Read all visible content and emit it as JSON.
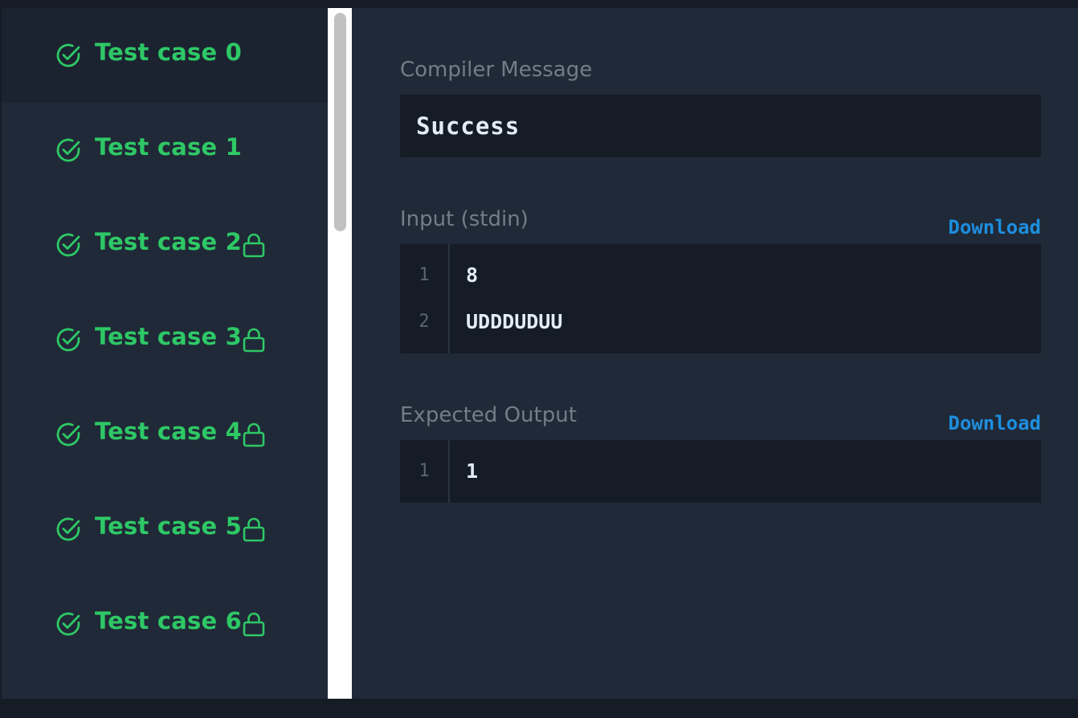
{
  "sidebar": {
    "items": [
      {
        "label": "Test case 0",
        "locked": false,
        "active": true,
        "status": "passed"
      },
      {
        "label": "Test case 1",
        "locked": false,
        "active": false,
        "status": "passed"
      },
      {
        "label": "Test case 2",
        "locked": true,
        "active": false,
        "status": "passed"
      },
      {
        "label": "Test case 3",
        "locked": true,
        "active": false,
        "status": "passed"
      },
      {
        "label": "Test case 4",
        "locked": true,
        "active": false,
        "status": "passed"
      },
      {
        "label": "Test case 5",
        "locked": true,
        "active": false,
        "status": "passed"
      },
      {
        "label": "Test case 6",
        "locked": true,
        "active": false,
        "status": "passed"
      }
    ]
  },
  "icons": {
    "pass": "check-circle-icon",
    "lock": "lock-icon"
  },
  "colors": {
    "pass_green": "#2ec866",
    "link_blue": "#1d8ede"
  },
  "compiler": {
    "label": "Compiler Message",
    "message": "Success"
  },
  "input": {
    "label": "Input (stdin)",
    "download_label": "Download",
    "lines": [
      {
        "num": "1",
        "text": "8"
      },
      {
        "num": "2",
        "text": "UDDDUDUU"
      }
    ]
  },
  "expected": {
    "label": "Expected Output",
    "download_label": "Download",
    "lines": [
      {
        "num": "1",
        "text": "1"
      }
    ]
  }
}
